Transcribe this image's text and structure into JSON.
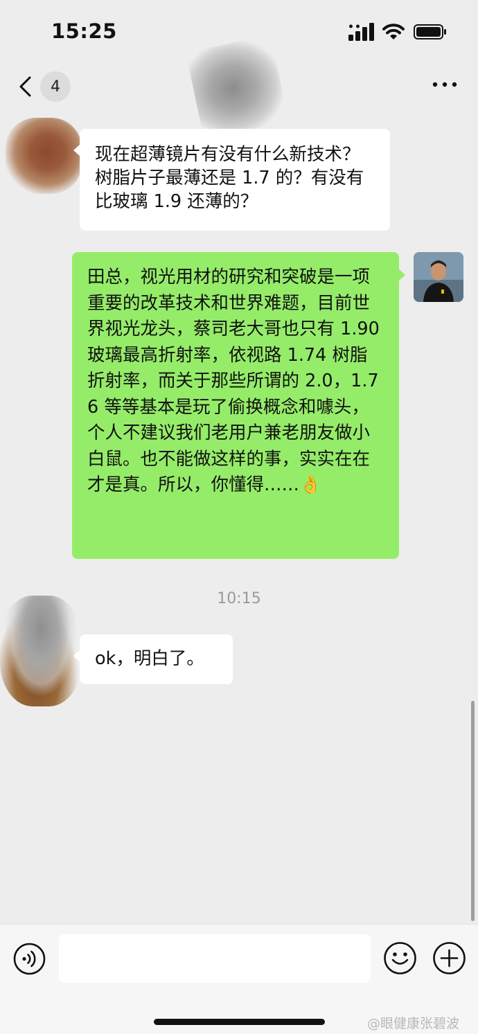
{
  "status_bar": {
    "time": "15:25"
  },
  "nav": {
    "unread_count": "4"
  },
  "chat": {
    "messages": [
      {
        "side": "left",
        "text": "现在超薄镜片有没有什么新技术？树脂片子最薄还是 1.7 的？有没有比玻璃 1.9 还薄的？"
      },
      {
        "side": "right",
        "text": "田总，视光用材的研究和突破是一项重要的改革技术和世界难题，目前世界视光龙头，蔡司老大哥也只有 1.90 玻璃最高折射率，依视路 1.74 树脂折射率，而关于那些所谓的 2.0，1.76 等等基本是玩了偷换概念和噱头，个人不建议我们老用户兼老朋友做小白鼠。也不能做这样的事，实实在在才是真。所以，你懂得……👌"
      },
      {
        "side": "left",
        "text": "ok，明白了。"
      }
    ],
    "timestamp": "10:15"
  },
  "input_bar": {
    "value": ""
  },
  "watermark": "@眼健康张碧波",
  "colors": {
    "background": "#ededed",
    "incoming_bubble": "#ffffff",
    "outgoing_bubble": "#95ec69"
  },
  "icons": [
    "back-chevron-icon",
    "more-icon",
    "voice-icon",
    "emoji-icon",
    "plus-icon",
    "signal-icon",
    "wifi-icon",
    "battery-icon"
  ]
}
